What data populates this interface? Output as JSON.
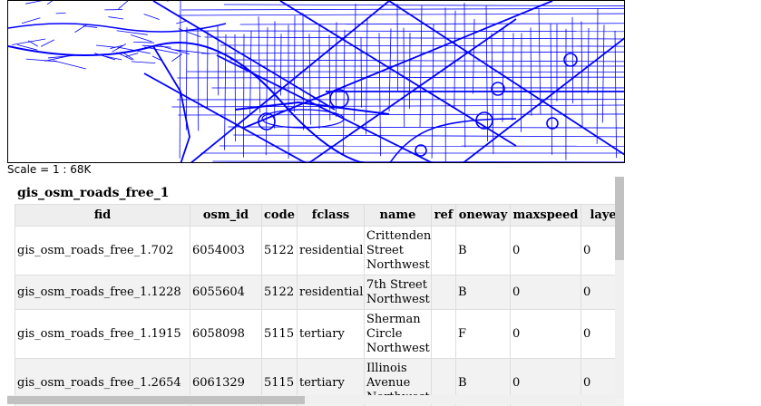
{
  "map": {
    "road_color": "#0000ff",
    "scale_label": "Scale = 1 : 68K"
  },
  "attribute_panel": {
    "layer_title": "gis_osm_roads_free_1",
    "columns": [
      "fid",
      "osm_id",
      "code",
      "fclass",
      "name",
      "ref",
      "oneway",
      "maxspeed",
      "layer"
    ],
    "rows": [
      {
        "fid": "gis_osm_roads_free_1.702",
        "osm_id": "6054003",
        "code": "5122",
        "fclass": "residential",
        "name": "Crittenden Street Northwest",
        "ref": "",
        "oneway": "B",
        "maxspeed": "0",
        "layer": "0"
      },
      {
        "fid": "gis_osm_roads_free_1.1228",
        "osm_id": "6055604",
        "code": "5122",
        "fclass": "residential",
        "name": "7th Street Northwest",
        "ref": "",
        "oneway": "B",
        "maxspeed": "0",
        "layer": "0"
      },
      {
        "fid": "gis_osm_roads_free_1.1915",
        "osm_id": "6058098",
        "code": "5115",
        "fclass": "tertiary",
        "name": "Sherman Circle Northwest",
        "ref": "",
        "oneway": "F",
        "maxspeed": "0",
        "layer": "0"
      },
      {
        "fid": "gis_osm_roads_free_1.2654",
        "osm_id": "6061329",
        "code": "5115",
        "fclass": "tertiary",
        "name": "Illinois Avenue Northwest",
        "ref": "",
        "oneway": "B",
        "maxspeed": "0",
        "layer": "0"
      }
    ]
  }
}
